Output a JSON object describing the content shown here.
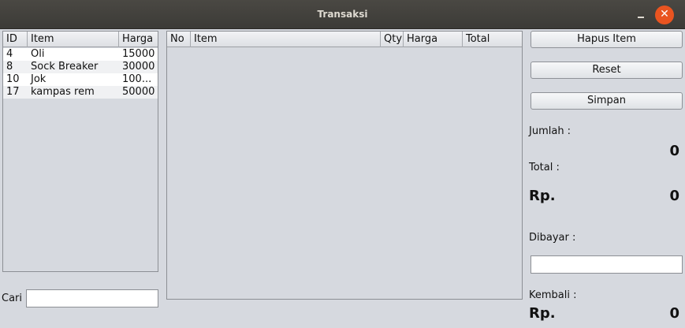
{
  "window": {
    "title": "Transaksi",
    "minimize_glyph": "–",
    "close_glyph": "✕"
  },
  "products": {
    "columns": [
      "ID",
      "Item",
      "Harga"
    ],
    "rows": [
      {
        "id": "4",
        "item": "Oli",
        "harga": "15000"
      },
      {
        "id": "8",
        "item": "Sock Breaker",
        "harga": "30000"
      },
      {
        "id": "10",
        "item": "Jok",
        "harga": "100..."
      },
      {
        "id": "17",
        "item": "kampas rem",
        "harga": "50000"
      }
    ]
  },
  "search": {
    "label": "Cari",
    "value": ""
  },
  "cart": {
    "columns": [
      "No",
      "Item",
      "Qty",
      "Harga",
      "Total"
    ],
    "rows": []
  },
  "actions": {
    "delete_label": "Hapus Item",
    "reset_label": "Reset",
    "save_label": "Simpan"
  },
  "summary": {
    "jumlah_label": "Jumlah :",
    "jumlah_value": "0",
    "total_label": "Total :",
    "currency": "Rp.",
    "total_value": "0",
    "dibayar_label": "Dibayar :",
    "dibayar_value": "",
    "kembali_label": "Kembali :",
    "kembali_value": "0"
  }
}
